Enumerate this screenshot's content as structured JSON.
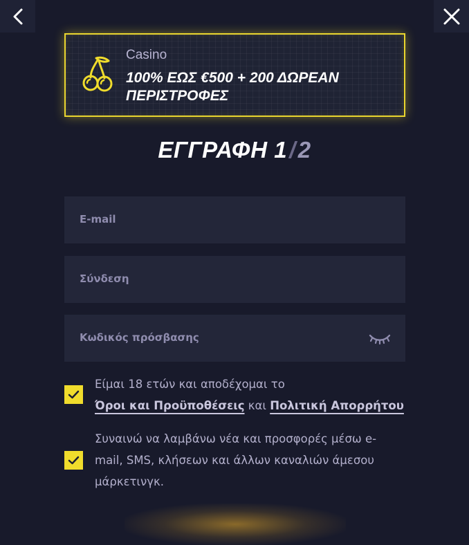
{
  "header": {
    "back_icon": "chevron-left-icon",
    "close_icon": "close-icon"
  },
  "promo": {
    "icon": "cherries-icon",
    "category": "Casino",
    "headline": "100% ΕΩΣ €500 + 200 ΔΩΡΕΑΝ ΠΕΡΙΣΤΡΟΦΕΣ",
    "accent_color": "#e9d52e"
  },
  "title": {
    "text": "ΕΓΓΡΑΦΗ",
    "step_current": "1",
    "separator": "/",
    "step_total": "2"
  },
  "form": {
    "email_label": "E-mail",
    "username_label": "Σύνδεση",
    "password_label": "Κωδικός πρόσβασης",
    "password_toggle_icon": "eye-closed-icon"
  },
  "consents": {
    "age_terms": {
      "checked": true,
      "text_before": "Είμαι 18 ετών και αποδέχομαι το",
      "terms_link": "Όροι και Προϋποθέσεις",
      "connector": "και",
      "privacy_link": "Πολιτική Απορρήτου"
    },
    "marketing": {
      "checked": true,
      "line1": "Συναινώ να λαμβάνω νέα και προσφορές μέσω e-",
      "line2": "mail, SMS, κλήσεων και άλλων καναλιών άμεσου",
      "line3": "μάρκετινγκ."
    }
  },
  "colors": {
    "background": "#181a2b",
    "field_background": "#232639",
    "checkbox": "#f0dc2c"
  }
}
